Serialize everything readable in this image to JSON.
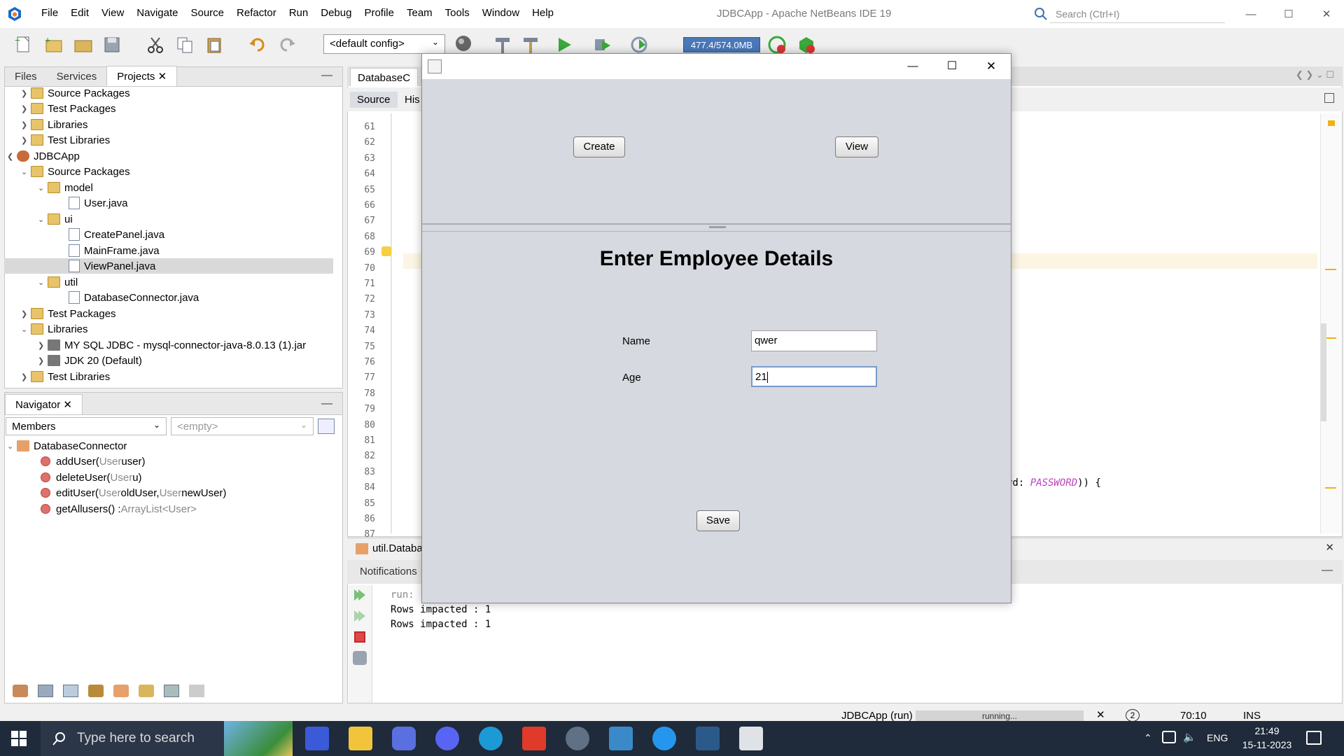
{
  "app": {
    "title": "JDBCApp - Apache NetBeans IDE 19",
    "menu": [
      "File",
      "Edit",
      "View",
      "Navigate",
      "Source",
      "Refactor",
      "Run",
      "Debug",
      "Profile",
      "Team",
      "Tools",
      "Window",
      "Help"
    ],
    "search_placeholder": "Search (Ctrl+I)"
  },
  "toolbar": {
    "config": "<default config>",
    "memory": "477.4/574.0MB"
  },
  "projects_panel": {
    "tabs": [
      "Files",
      "Services",
      "Projects"
    ],
    "tree": [
      "Source Packages",
      "Test Packages",
      "Libraries",
      "Test Libraries",
      "JDBCApp",
      "Source Packages",
      "model",
      "User.java",
      "ui",
      "CreatePanel.java",
      "MainFrame.java",
      "ViewPanel.java",
      "util",
      "DatabaseConnector.java",
      "Test Packages",
      "Libraries",
      "MY SQL JDBC - mysql-connector-java-8.0.13 (1).jar",
      "JDK 20 (Default)",
      "Test Libraries"
    ]
  },
  "navigator": {
    "title": "Navigator",
    "filter": "Members",
    "empty": "<empty>",
    "class": "DatabaseConnector",
    "members": [
      {
        "name": "addUser",
        "params": "(",
        "ptype": "User",
        "pname": " user)",
        "ret": ""
      },
      {
        "name": "deleteUser",
        "params": "(",
        "ptype": "User",
        "pname": " u)",
        "ret": ""
      },
      {
        "name": "editUser",
        "params": "(",
        "ptype": "User",
        "pname": " oldUser, ",
        "ptype2": "User",
        "pname2": " newUser)",
        "ret": ""
      },
      {
        "name": "getAllusers",
        "params": "() : ",
        "ptype": "",
        "pname": "",
        "ret": "ArrayList<User>"
      }
    ]
  },
  "editor": {
    "tab": "DatabaseC",
    "sub_tabs": [
      "Source",
      "His"
    ],
    "line_numbers": [
      "61",
      "62",
      "63",
      "64",
      "65",
      "66",
      "67",
      "68",
      "69",
      "70",
      "71",
      "72",
      "73",
      "74",
      "75",
      "76",
      "77",
      "78",
      "79",
      "80",
      "81",
      "82",
      "83",
      "84",
      "85",
      "86",
      "87"
    ],
    "code_fragment_prefix": "rd: ",
    "code_fragment_param": "PASSWORD",
    "code_fragment_suffix": ")) {",
    "status_file": "util.Databa"
  },
  "output": {
    "tab": "Notifications",
    "lines": [
      "run:",
      "Rows impacted : 1",
      "Rows impacted : 1"
    ]
  },
  "statusbar": {
    "project": "JDBCApp (run)",
    "progress": "running...",
    "notifications": "2",
    "position": "70:10",
    "mode": "INS"
  },
  "dialog": {
    "create_button": "Create",
    "view_button": "View",
    "heading": "Enter Employee Details",
    "name_label": "Name",
    "name_value": "qwer",
    "age_label": "Age",
    "age_value": "21",
    "save_button": "Save"
  },
  "taskbar": {
    "search_placeholder": "Type here to search",
    "language": "ENG",
    "time": "21:49",
    "date": "15-11-2023"
  }
}
